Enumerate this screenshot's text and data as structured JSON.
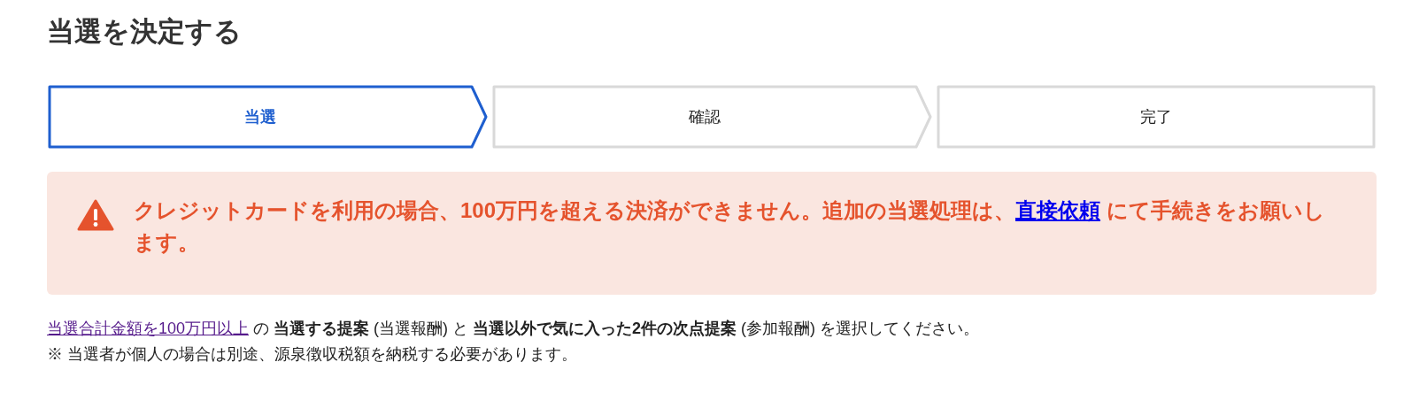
{
  "page_title": "当選を決定する",
  "steps": [
    {
      "label": "当選",
      "selected": true,
      "kind": "arrow"
    },
    {
      "label": "確認",
      "selected": false,
      "kind": "arrow"
    },
    {
      "label": "完了",
      "selected": false,
      "kind": "end"
    }
  ],
  "alert": {
    "before": "クレジットカードを利用の場合、100万円を超える決済ができません。追加の当選処理は、",
    "link": "直接依頼",
    "after": " にて手続きをお願いします。"
  },
  "instructions": {
    "link": "当選合計金額を100万円以上",
    "text": " の **当選する提案** (当選報酬) と **当選以外で気に入った2件の次点提案** (参加報酬) を選択してください。"
  },
  "note": "※ 当選者が個人の場合は別途、源泉徴収税額を納税する必要があります。"
}
